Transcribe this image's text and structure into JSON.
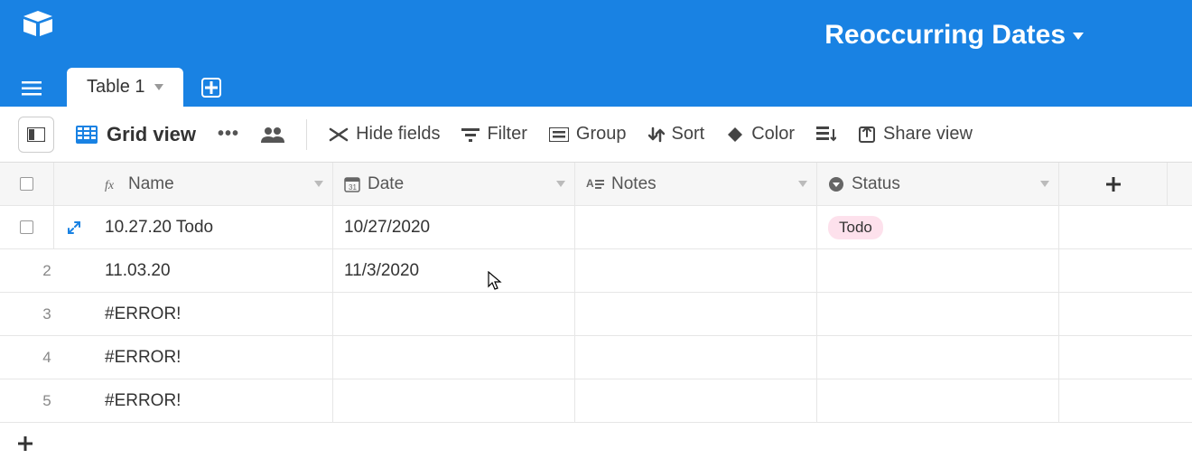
{
  "header": {
    "base_name": "Reoccurring Dates"
  },
  "tabs": {
    "active": "Table 1"
  },
  "toolbar": {
    "view_name": "Grid view",
    "hide_fields": "Hide fields",
    "filter": "Filter",
    "group": "Group",
    "sort": "Sort",
    "color": "Color",
    "share": "Share view"
  },
  "columns": {
    "name": "Name",
    "date": "Date",
    "notes": "Notes",
    "status": "Status"
  },
  "rows": [
    {
      "num": "",
      "name": "10.27.20 Todo",
      "date": "10/27/2020",
      "notes": "",
      "status": "Todo",
      "active": true
    },
    {
      "num": "2",
      "name": "11.03.20",
      "date": "11/3/2020",
      "notes": "",
      "status": ""
    },
    {
      "num": "3",
      "name": "#ERROR!",
      "date": "",
      "notes": "",
      "status": ""
    },
    {
      "num": "4",
      "name": "#ERROR!",
      "date": "",
      "notes": "",
      "status": ""
    },
    {
      "num": "5",
      "name": "#ERROR!",
      "date": "",
      "notes": "",
      "status": ""
    }
  ],
  "colors": {
    "brand": "#1982e3",
    "tag_bg": "#fde1ec"
  }
}
